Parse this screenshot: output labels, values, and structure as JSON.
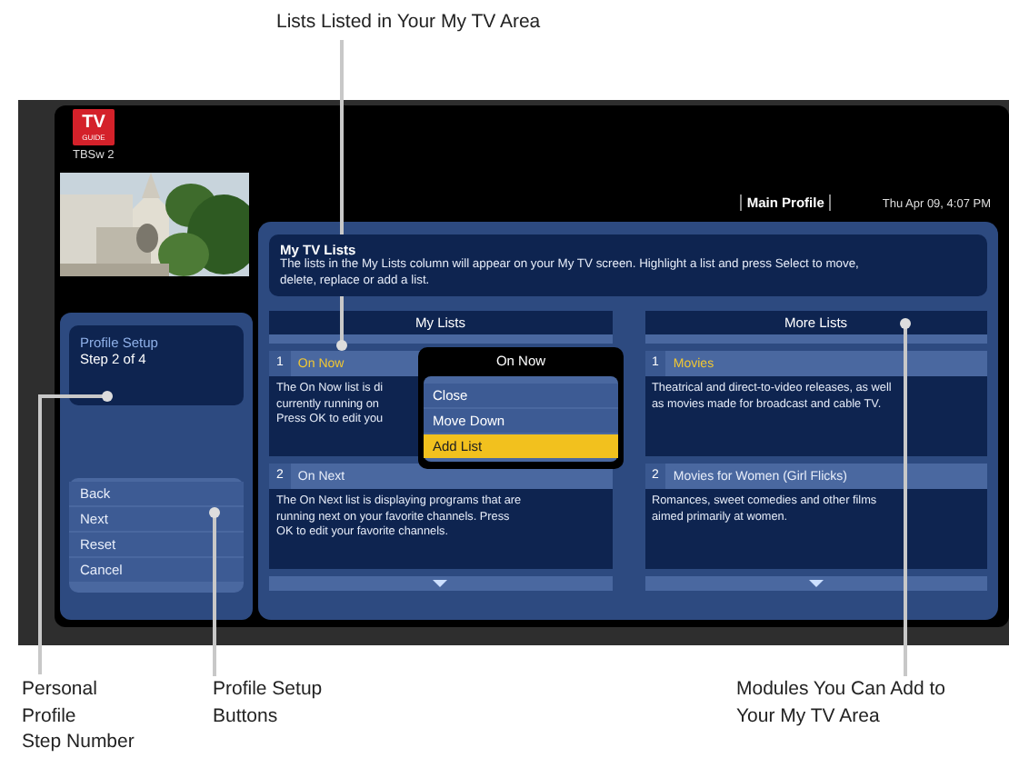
{
  "caption_top": "Lists Listed in Your My TV Area",
  "logo": {
    "line1": "TV",
    "line2": "GUIDE"
  },
  "channel": "TBSw 2",
  "header": {
    "profile": "Main Profile",
    "datetime": "Thu Apr 09, 4:07 PM"
  },
  "intro": {
    "title": "My TV Lists",
    "text": "The lists in the My Lists column will appear on your My TV screen. Highlight a list and press Select to move, delete, replace or add a list."
  },
  "profile_setup": {
    "title": "Profile Setup",
    "step": "Step 2 of 4"
  },
  "setup_buttons": [
    "Back",
    "Next",
    "Reset",
    "Cancel"
  ],
  "columns": [
    {
      "heading": "My Lists",
      "items": [
        {
          "number": "1",
          "name": "On Now",
          "selected": true,
          "description_lines": [
            "The On Now list is di",
            "currently running on",
            "Press OK to edit you"
          ]
        },
        {
          "number": "2",
          "name": "On Next",
          "selected": false,
          "description_lines": [
            "The On Next list is displaying programs that are",
            "running next on your favorite channels. Press",
            "OK to edit your favorite channels."
          ]
        }
      ]
    },
    {
      "heading": "More Lists",
      "items": [
        {
          "number": "1",
          "name": "Movies",
          "selected": true,
          "description_lines": [
            "Theatrical and direct-to-video releases, as well",
            "as movies made for broadcast and cable TV."
          ]
        },
        {
          "number": "2",
          "name": "Movies for Women (Girl Flicks)",
          "selected": false,
          "description_lines": [
            "Romances, sweet comedies and other films",
            "aimed primarily at women."
          ]
        }
      ]
    }
  ],
  "popup": {
    "title": "On Now",
    "options": [
      {
        "label": "Close",
        "selected": false
      },
      {
        "label": "Move Down",
        "selected": false
      },
      {
        "label": "Add List",
        "selected": true
      }
    ]
  },
  "bottom_captions": [
    {
      "lines": [
        "Personal",
        "Profile",
        "Step Number"
      ]
    },
    {
      "lines": [
        "Profile Setup",
        "Buttons"
      ]
    },
    {
      "lines": [
        "Modules You Can Add to",
        "Your My TV Area"
      ]
    }
  ]
}
